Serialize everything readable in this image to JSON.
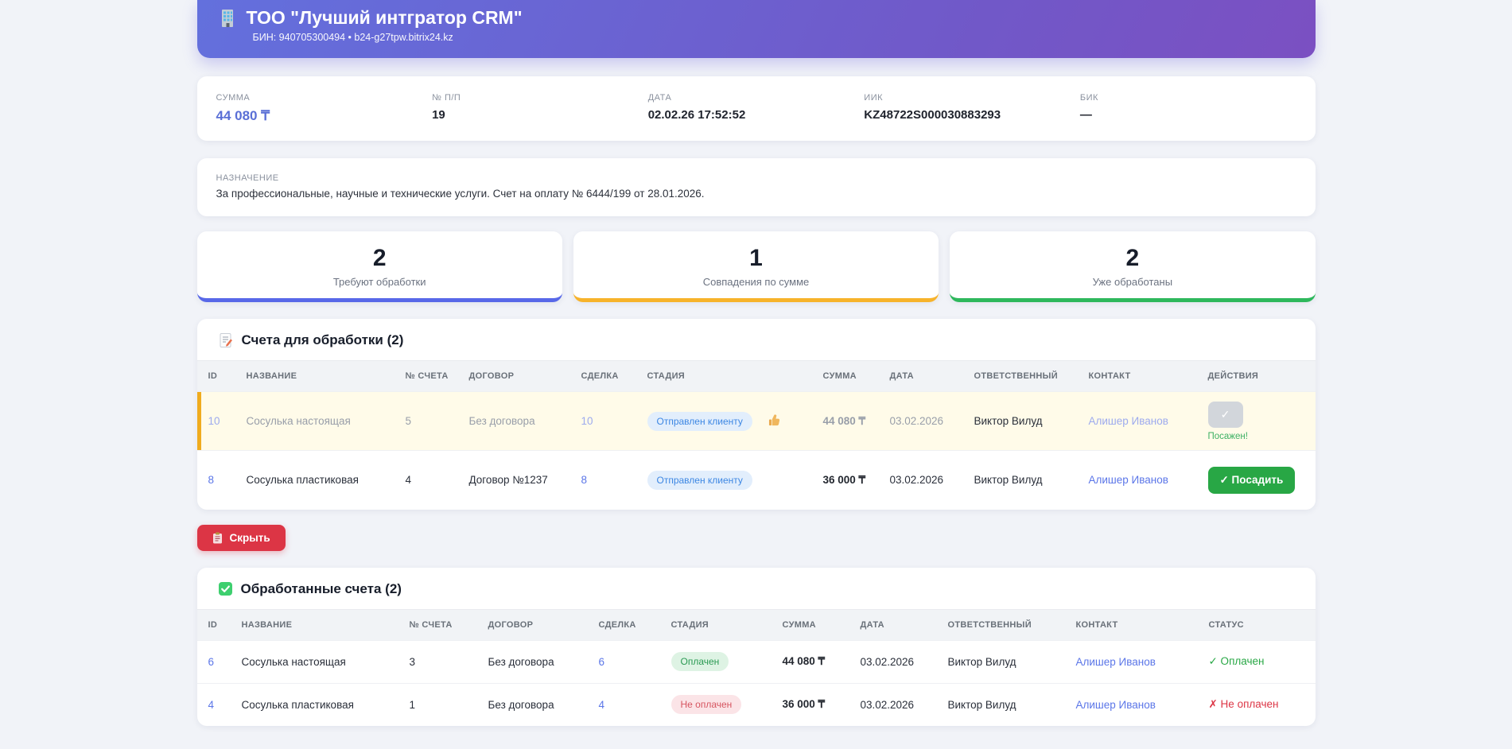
{
  "header": {
    "title": "ТОО \"Лучший интгратор CRM\"",
    "subtitle": "БИН: 940705300494 • b24-g27tpw.bitrix24.kz"
  },
  "payment": {
    "fields": [
      {
        "label": "СУММА",
        "value": "44 080 ₸"
      },
      {
        "label": "№ П/П",
        "value": "19"
      },
      {
        "label": "ДАТА",
        "value": "02.02.26 17:52:52"
      },
      {
        "label": "ИИК",
        "value": "KZ48722S000030883293"
      },
      {
        "label": "БИК",
        "value": "—"
      }
    ]
  },
  "purpose": {
    "label": "НАЗНАЧЕНИЕ",
    "text": "За профессиональные, научные и технические услуги. Счет на оплату № 6444/199 от 28.01.2026."
  },
  "stats": [
    {
      "value": "2",
      "label": "Требуют обработки",
      "color": "#5868e8"
    },
    {
      "value": "1",
      "label": "Совпадения по сумме",
      "color": "#f7b32b"
    },
    {
      "value": "2",
      "label": "Уже обработаны",
      "color": "#2eb85c"
    }
  ],
  "pending_table": {
    "title": "Счета для обработки (2)",
    "columns": [
      "ID",
      "НАЗВАНИЕ",
      "№ СЧЕТА",
      "ДОГОВОР",
      "СДЕЛКА",
      "СТАДИЯ",
      "СУММА",
      "ДАТА",
      "ОТВЕТСТВЕННЫЙ",
      "КОНТАКТ",
      "ДЕЙСТВИЯ"
    ],
    "rows": [
      {
        "id": "10",
        "name": "Сосулька настоящая",
        "invoice_no": "5",
        "contract": "Без договора",
        "deal": "10",
        "stage": "Отправлен клиенту",
        "sum": "44 080 ₸",
        "date": "03.02.2026",
        "responsible": "Виктор Вилуд",
        "contact": "Алишер Иванов",
        "action": {
          "button": "✓",
          "note": "Посажен!"
        }
      },
      {
        "id": "8",
        "name": "Сосулька пластиковая",
        "invoice_no": "4",
        "contract": "Договор №1237",
        "deal": "8",
        "stage": "Отправлен клиенту",
        "sum": "36 000 ₸",
        "date": "03.02.2026",
        "responsible": "Виктор Вилуд",
        "contact": "Алишер Иванов",
        "action": {
          "button": "✓ Посадить"
        }
      }
    ]
  },
  "hide_button": {
    "label": "Скрыть"
  },
  "processed_table": {
    "title": "Обработанные счета (2)",
    "columns": [
      "ID",
      "НАЗВАНИЕ",
      "№ СЧЕТА",
      "ДОГОВОР",
      "СДЕЛКА",
      "СТАДИЯ",
      "СУММА",
      "ДАТА",
      "ОТВЕТСТВЕННЫЙ",
      "КОНТАКТ",
      "СТАТУС"
    ],
    "rows": [
      {
        "id": "6",
        "name": "Сосулька настоящая",
        "invoice_no": "3",
        "contract": "Без договора",
        "deal": "6",
        "stage": "Оплачен",
        "sum": "44 080 ₸",
        "date": "03.02.2026",
        "responsible": "Виктор Вилуд",
        "contact": "Алишер Иванов",
        "status": "✓ Оплачен"
      },
      {
        "id": "4",
        "name": "Сосулька пластиковая",
        "invoice_no": "1",
        "contract": "Без договора",
        "deal": "4",
        "stage": "Не оплачен",
        "sum": "36 000 ₸",
        "date": "03.02.2026",
        "responsible": "Виктор Вилуд",
        "contact": "Алишер Иванов",
        "status": "✗ Не оплачен"
      }
    ]
  },
  "colors": {
    "header_gradient_start": "#6370dd",
    "header_gradient_end": "#7b50c2",
    "accent_blue": "#5a6fd6",
    "stat_blue": "#5868e8",
    "stat_amber": "#f7b32b",
    "stat_green": "#2eb85c",
    "highlight_row_bg": "#fffbe9",
    "highlight_row_border": "#f0ab1e",
    "button_green": "#28a745",
    "button_red": "#dc3545",
    "link_blue": "#5b76e8"
  }
}
